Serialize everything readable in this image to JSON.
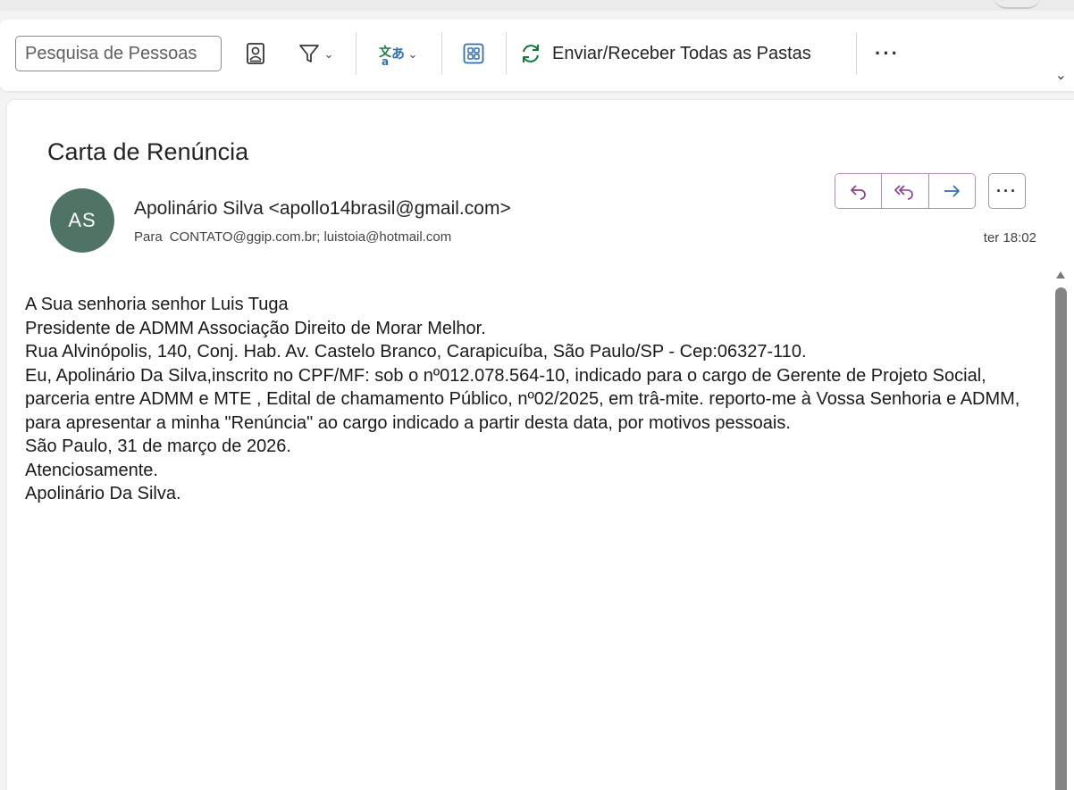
{
  "toolbar": {
    "search_placeholder": "Pesquisa de Pessoas",
    "send_receive_label": "Enviar/Receber Todas as Pastas",
    "more_label": "···"
  },
  "message": {
    "subject": "Carta de Renúncia",
    "avatar_initials": "AS",
    "sender": "Apolinário Silva <apollo14brasil@gmail.com>",
    "to_label": "Para",
    "recipients": "CONTATO@ggip.com.br; luistoia@hotmail.com",
    "time": "ter 18:02",
    "more_label": "···",
    "body_lines": [
      "A Sua senhoria senhor Luis Tuga",
      "Presidente de ADMM Associação  Direito de Morar Melhor.",
      "Rua Alvinópolis,  140, Conj. Hab. Av. Castelo Branco, Carapicuíba, São Paulo/SP - Cep:06327-110.",
      "Eu, Apolinário  Da Silva,inscrito no CPF/MF: sob o nº012.078.564-10, indicado para o cargo de Gerente de Projeto Social, parceria entre ADMM e MTE , Edital de chamamento Público,  nº02/2025, em trâ-mite.  reporto-me à Vossa Senhoria e ADMM, para apresentar a minha \"Renúncia\" ao cargo indicado a partir desta data, por motivos pessoais.",
      "São Paulo, 31 de março de 2026.",
      "Atenciosamente.",
      "Apolinário Da Silva."
    ]
  },
  "colors": {
    "avatar_bg": "#4f7466",
    "action_border": "#b98ab9",
    "action_icon": "#8a3d8a",
    "forward_icon": "#2f6fb5",
    "sync_icon": "#0f7b3f"
  },
  "icons": {
    "contacts": "contact-card-icon",
    "filter": "filter-icon",
    "translate": "translate-icon",
    "apps": "apps-grid-icon",
    "sync": "sync-icon",
    "reply": "reply-icon",
    "reply_all": "reply-all-icon",
    "forward": "forward-icon"
  }
}
